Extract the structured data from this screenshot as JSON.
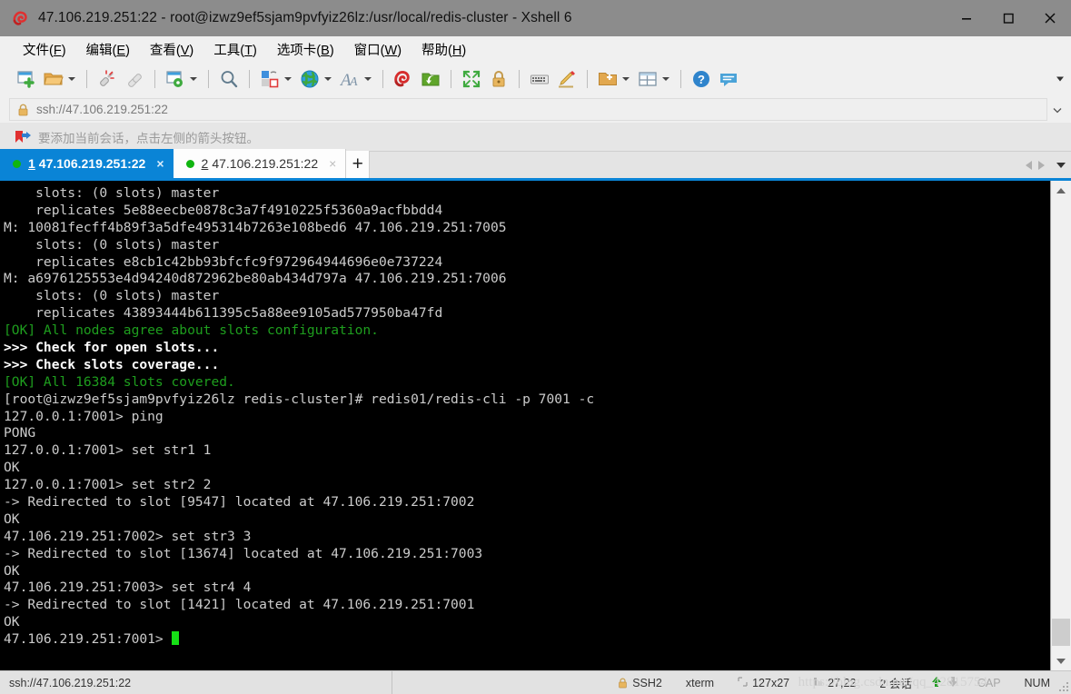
{
  "window": {
    "title": "47.106.219.251:22 - root@izwz9ef5sjam9pvfyiz26lz:/usr/local/redis-cluster - Xshell 6",
    "app_icon": "xshell-icon",
    "minimize_label": "–",
    "maximize_label": "□",
    "close_label": "✕"
  },
  "menubar": [
    {
      "name": "file",
      "text": "文件(F)",
      "pre": "文件(",
      "key": "F",
      "post": ")"
    },
    {
      "name": "edit",
      "text": "编辑(E)",
      "pre": "编辑(",
      "key": "E",
      "post": ")"
    },
    {
      "name": "view",
      "text": "查看(V)",
      "pre": "查看(",
      "key": "V",
      "post": ")"
    },
    {
      "name": "tools",
      "text": "工具(T)",
      "pre": "工具(",
      "key": "T",
      "post": ")"
    },
    {
      "name": "tabs",
      "text": "选项卡(B)",
      "pre": "选项卡(",
      "key": "B",
      "post": ")"
    },
    {
      "name": "window",
      "text": "窗口(W)",
      "pre": "窗口(",
      "key": "W",
      "post": ")"
    },
    {
      "name": "help",
      "text": "帮助(H)",
      "pre": "帮助(",
      "key": "H",
      "post": ")"
    }
  ],
  "toolbar": {
    "items": [
      {
        "icon": "new-session-icon",
        "caret": false
      },
      {
        "icon": "open-folder-icon",
        "caret": true
      },
      {
        "sep": true
      },
      {
        "icon": "disconnect-icon",
        "caret": false
      },
      {
        "icon": "reconnect-icon",
        "caret": false
      },
      {
        "sep": true
      },
      {
        "icon": "session-properties-icon",
        "caret": true
      },
      {
        "sep": true
      },
      {
        "icon": "find-icon",
        "caret": false
      },
      {
        "sep": true
      },
      {
        "icon": "copy-paste-icon",
        "caret": true
      },
      {
        "icon": "globe-encoding-icon",
        "caret": true
      },
      {
        "icon": "font-icon",
        "caret": true
      },
      {
        "sep": true
      },
      {
        "icon": "xshell-logo-icon",
        "caret": false
      },
      {
        "icon": "xftp-icon",
        "caret": false
      },
      {
        "sep": true
      },
      {
        "icon": "fullscreen-icon",
        "caret": false
      },
      {
        "icon": "lock-icon",
        "caret": false
      },
      {
        "sep": true
      },
      {
        "icon": "keyboard-icon",
        "caret": false
      },
      {
        "icon": "highlight-icon",
        "caret": false
      },
      {
        "sep": true
      },
      {
        "icon": "new-folder-icon",
        "caret": true
      },
      {
        "icon": "layout-icon",
        "caret": true
      },
      {
        "sep": true
      },
      {
        "icon": "help-icon",
        "caret": false
      },
      {
        "icon": "feedback-icon",
        "caret": false
      }
    ],
    "overflow_caret": "overflow-chevron-icon"
  },
  "addressbar": {
    "lock_icon": "lock-icon",
    "value": "ssh://47.106.219.251:22",
    "placeholder": "ssh://",
    "dropdown_icon": "chevron-down-icon"
  },
  "notification": {
    "icon": "bookmark-arrow-icon",
    "text": "要添加当前会话，点击左侧的箭头按钮。"
  },
  "tabs": {
    "items": [
      {
        "num": "1",
        "label": "47.106.219.251:22",
        "active": true,
        "status": "connected",
        "close": "×"
      },
      {
        "num": "2",
        "label": "47.106.219.251:22",
        "active": false,
        "status": "connected",
        "close": "×"
      }
    ],
    "add_label": "+",
    "nav_prev_icon": "chevron-left-icon",
    "nav_next_icon": "chevron-right-icon",
    "list_icon": "chevron-down-icon"
  },
  "terminal": {
    "cursor": "block-cursor",
    "lines": [
      {
        "text": "    slots: (0 slots) master",
        "style": "white"
      },
      {
        "text": "    replicates 5e88eecbe0878c3a7f4910225f5360a9acfbbdd4",
        "style": "white"
      },
      {
        "text": "M: 10081fecff4b89f3a5dfe495314b7263e108bed6 47.106.219.251:7005",
        "style": "white"
      },
      {
        "text": "    slots: (0 slots) master",
        "style": "white"
      },
      {
        "text": "    replicates e8cb1c42bb93bfcfc9f972964944696e0e737224",
        "style": "white"
      },
      {
        "text": "M: a6976125553e4d94240d872962be80ab434d797a 47.106.219.251:7006",
        "style": "white"
      },
      {
        "text": "    slots: (0 slots) master",
        "style": "white"
      },
      {
        "text": "    replicates 43893444b611395c5a88ee9105ad577950ba47fd",
        "style": "white"
      },
      {
        "text": "[OK] All nodes agree about slots configuration.",
        "style": "green"
      },
      {
        "text": ">>> Check for open slots...",
        "style": "bold"
      },
      {
        "text": ">>> Check slots coverage...",
        "style": "bold"
      },
      {
        "text": "[OK] All 16384 slots covered.",
        "style": "green"
      },
      {
        "text": "[root@izwz9ef5sjam9pvfyiz26lz redis-cluster]# redis01/redis-cli -p 7001 -c",
        "style": "white"
      },
      {
        "text": "127.0.0.1:7001> ping",
        "style": "white"
      },
      {
        "text": "PONG",
        "style": "white"
      },
      {
        "text": "127.0.0.1:7001> set str1 1",
        "style": "white"
      },
      {
        "text": "OK",
        "style": "white"
      },
      {
        "text": "127.0.0.1:7001> set str2 2",
        "style": "white"
      },
      {
        "text": "-> Redirected to slot [9547] located at 47.106.219.251:7002",
        "style": "white"
      },
      {
        "text": "OK",
        "style": "white"
      },
      {
        "text": "47.106.219.251:7002> set str3 3",
        "style": "white"
      },
      {
        "text": "-> Redirected to slot [13674] located at 47.106.219.251:7003",
        "style": "white"
      },
      {
        "text": "OK",
        "style": "white"
      },
      {
        "text": "47.106.219.251:7003> set str4 4",
        "style": "white"
      },
      {
        "text": "-> Redirected to slot [1421] located at 47.106.219.251:7001",
        "style": "white"
      },
      {
        "text": "OK",
        "style": "white"
      },
      {
        "text": "47.106.219.251:7001> ",
        "style": "white",
        "cursor": true
      }
    ]
  },
  "scrollbar": {
    "up_icon": "chevron-up-icon",
    "down_icon": "chevron-down-icon",
    "thumb": "scroll-thumb"
  },
  "statusbar": {
    "path": "ssh://47.106.219.251:22",
    "protocol": "SSH2",
    "term_type": "xterm",
    "size": "127x27",
    "cursor_pos": "27,22",
    "sessions": "2 会话",
    "cap": "CAP",
    "num": "NUM",
    "watermark": "https://blog.csdn.net/qq_42815754",
    "lock_icon": "lock-icon",
    "size_icon": "terminal-size-icon",
    "cursor_icon": "cursor-pos-icon",
    "up_icon": "transfer-up-icon",
    "down_icon": "transfer-down-icon"
  },
  "colors": {
    "accent": "#0a84d6",
    "titlebar": "#8c8c8c",
    "chrome": "#f0f0f0",
    "terminal_bg": "#000000",
    "terminal_fg": "#cccccc",
    "terminal_green": "#1e9e1e",
    "cursor_green": "#16e016",
    "status_dot": "#10b510"
  }
}
